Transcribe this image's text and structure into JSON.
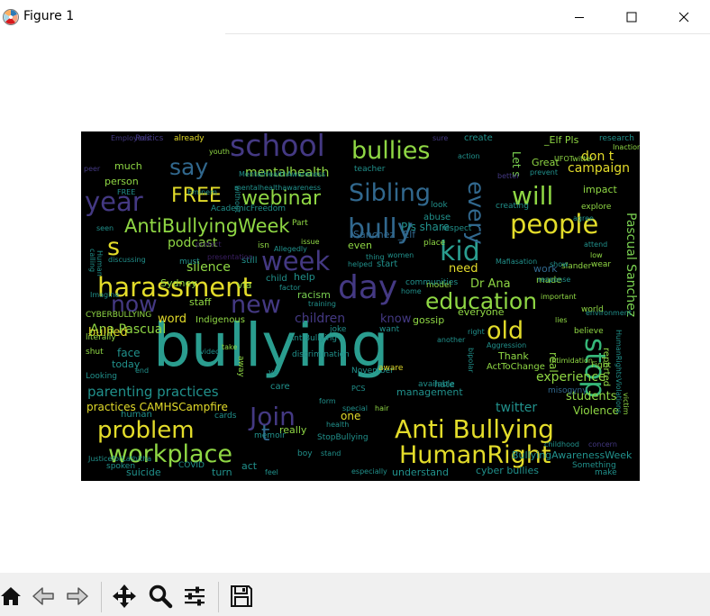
{
  "window": {
    "title": "Figure 1"
  },
  "toolbar": {
    "buttons": [
      "home-icon",
      "back-arrow-icon",
      "forward-arrow-icon",
      "pan-icon",
      "zoom-icon",
      "configure-subplots-icon",
      "save-icon"
    ]
  },
  "wordcloud": {
    "words": [
      "bullying",
      "Anti Bullying",
      "HumanRight",
      "harassment",
      "education",
      "school",
      "bullies",
      "day",
      "people",
      "kid",
      "workplace",
      "problem",
      "Sibling",
      "bully",
      "AntiBullyingWeek",
      "webinar",
      "year",
      "week",
      "new",
      "FREE",
      "Join",
      "will",
      "say",
      "stop",
      "old",
      "every",
      "s",
      "t",
      "now",
      "Pascual Sanchez",
      "Ana Pascual",
      "mentalhealth",
      "parenting practices",
      "practices CAMHSCampfire",
      "children",
      "silence",
      "podcast",
      "experience",
      "twitter",
      "Violence",
      "students",
      "know",
      "need",
      "Dr Ana",
      "campaign",
      "don t",
      "impact",
      "bullied",
      "word",
      "face",
      "today",
      "Pls share",
      "Sanchez _Elf",
      "_Elf Pls",
      "BullyingAwarenessWeek",
      "cyber bullies",
      "understand",
      "suicide",
      "turn",
      "act",
      "really",
      "one",
      "racism",
      "help",
      "gossip",
      "everyone",
      "management",
      "Great",
      "Let s",
      "abuse",
      "even",
      "start",
      "made",
      "work",
      "real",
      "Thank",
      "ActToChange",
      "Sydney",
      "staff",
      "via",
      "Indigenous",
      "CYBERBULLYING",
      "literally",
      "shut",
      "Looking",
      "human",
      "cards",
      "memoir",
      "spoken",
      "COVID",
      "Something",
      "make",
      "JusticeforLathitha",
      "StopBullying",
      "AntiBullying",
      "hate",
      "available",
      "model",
      "communities",
      "isn",
      "still",
      "must",
      "much",
      "person",
      "create",
      "research",
      "already",
      "Politics",
      "Employees",
      "youth",
      "peer",
      "teacher",
      "UFOTwitter",
      "Inaction",
      "AcademicFreedom",
      "Eminem",
      "mentalhealthawareness",
      "MentalHealthAwareness",
      "issue",
      "Part",
      "Allegedly",
      "presentation",
      "protect",
      "place",
      "respect",
      "look",
      "sure",
      "action",
      "better",
      "creating",
      "explore",
      "agree",
      "attend",
      "low",
      "slander",
      "wear",
      "Mafiasation",
      "important",
      "world",
      "lies",
      "believe",
      "Fight",
      "HumanRightsViolations",
      "reported",
      "victim",
      "intimidation",
      "misogyny",
      "childhood",
      "concern",
      "Aggression",
      "right",
      "another",
      "want",
      "joke",
      "training",
      "November",
      "aware",
      "PCS",
      "form",
      "special",
      "hair",
      "health",
      "stand",
      "boy",
      "feel",
      "especially",
      "discrimination",
      "ve",
      "care",
      "child",
      "factor",
      "video",
      "take",
      "away",
      "end",
      "Imagine",
      "seen",
      "discussing",
      "home",
      "women",
      "thing",
      "helped",
      "show",
      "without",
      "FREE",
      "calling",
      "Human",
      "prevent",
      "bipolar",
      "response",
      "environment"
    ]
  }
}
